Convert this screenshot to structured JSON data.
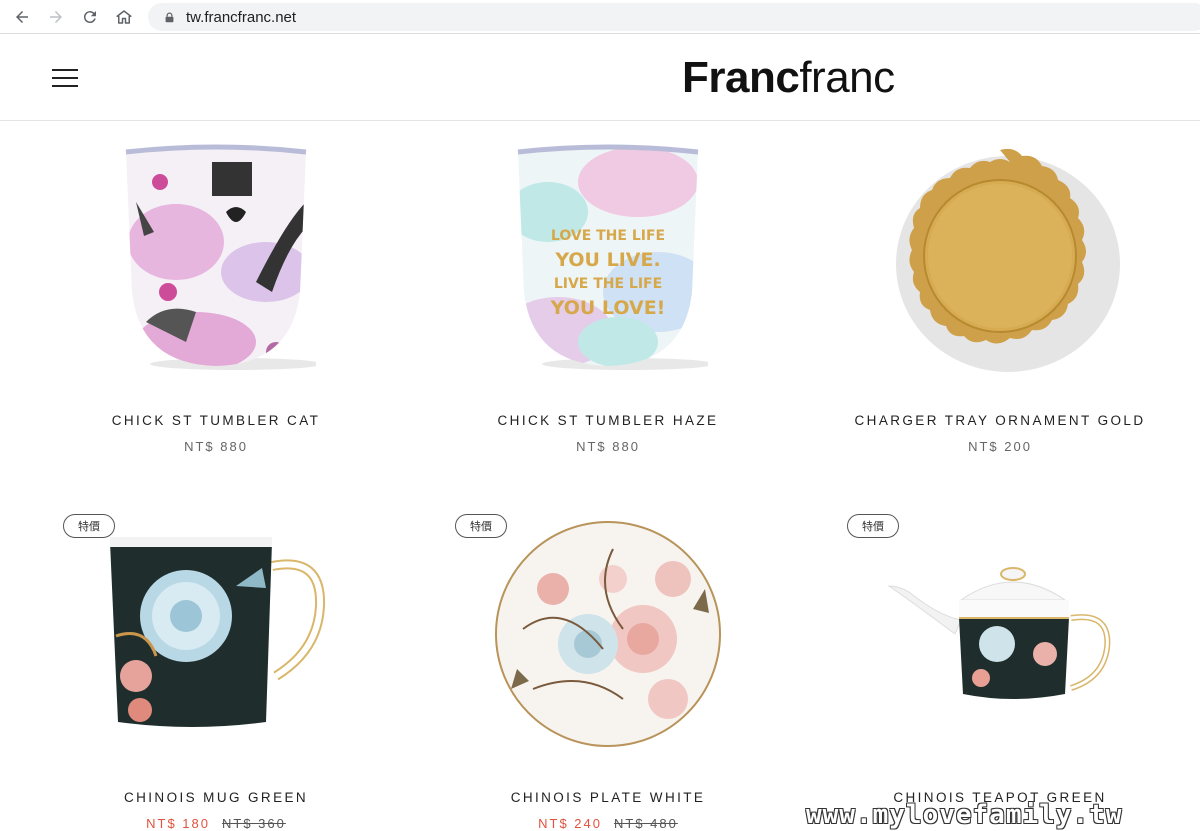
{
  "browser": {
    "url": "tw.francfranc.net"
  },
  "header": {
    "logo_bold": "Franc",
    "logo_light": "franc"
  },
  "products": [
    {
      "name": "CHICK ST TUMBLER CAT",
      "price": "NT$ 880",
      "badge": "",
      "image": "cat-tumbler"
    },
    {
      "name": "CHICK ST TUMBLER HAZE",
      "price": "NT$ 880",
      "badge": "",
      "image": "haze-tumbler"
    },
    {
      "name": "CHARGER TRAY ORNAMENT GOLD",
      "price": "NT$ 200",
      "badge": "",
      "image": "gold-tray"
    },
    {
      "name": "CHINOIS MUG GREEN",
      "sale_price": "NT$ 180",
      "original_price": "NT$ 360",
      "badge": "特價",
      "image": "chinois-mug"
    },
    {
      "name": "CHINOIS PLATE WHITE",
      "sale_price": "NT$ 240",
      "original_price": "NT$ 480",
      "badge": "特價",
      "image": "chinois-plate"
    },
    {
      "name": "CHINOIS TEAPOT GREEN",
      "sale_price": "",
      "original_price": "",
      "badge": "特價",
      "image": "chinois-teapot"
    }
  ],
  "tumbler_text": [
    "LOVE THE LIFE",
    "YOU LIVE.",
    "LIVE THE LIFE",
    "YOU LOVE!"
  ],
  "watermark": "www.mylovefamily.tw",
  "colors": {
    "sale": "#e0533f",
    "gold": "#d4a850",
    "dark_green": "#1f2e2c"
  }
}
